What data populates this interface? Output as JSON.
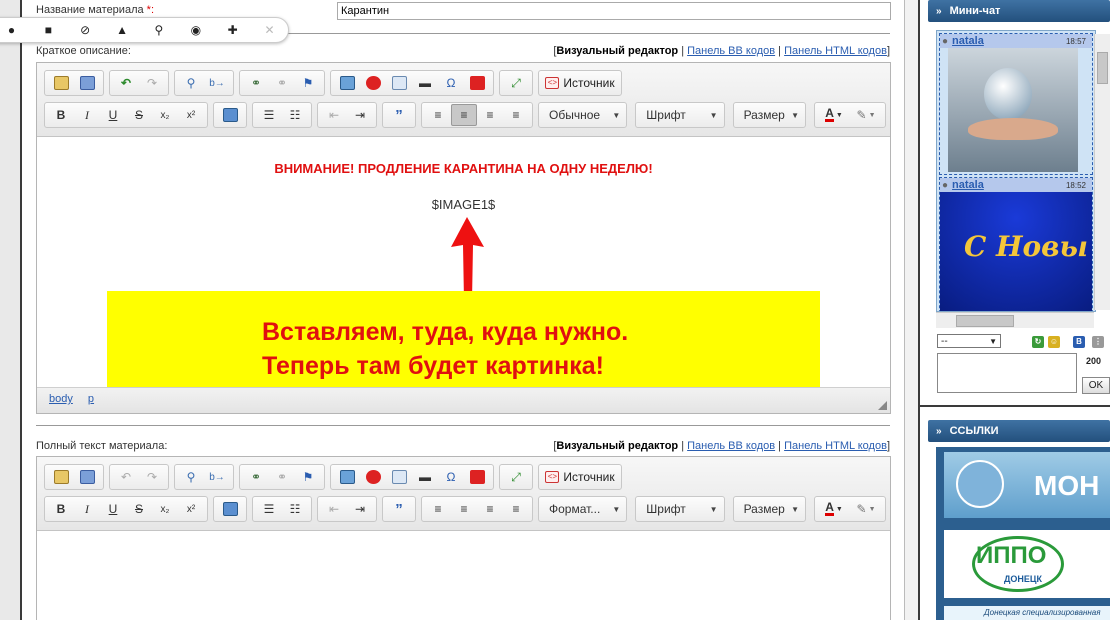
{
  "float_toolbar": {
    "icons": [
      "plus-icon",
      "folder-icon",
      "block-icon",
      "bell-icon",
      "search-icon",
      "eye-icon",
      "puzzle-icon",
      "close-icon"
    ]
  },
  "form": {
    "title_label": "Название материала",
    "required_mark": "*:",
    "title_value": "Карантин",
    "short_label": "Краткое описание:",
    "full_label": "Полный текст материала:"
  },
  "modes": {
    "visual": "Визуальный редактор",
    "bb": "Панель BB кодов",
    "html": "Панель HTML кодов",
    "sep": "|",
    "open": "[",
    "close": "]"
  },
  "editor1": {
    "source_label": "Источник",
    "format_combo": "Обычное",
    "font_combo": "Шрифт",
    "size_combo": "Размер",
    "warning_text": "ВНИМАНИЕ! ПРОДЛЕНИЕ КАРАНТИНА НА ОДНУ НЕДЕЛЮ!",
    "image_placeholder": "$IMAGE1$",
    "callout_line1": "Вставляем, туда, куда нужно.",
    "callout_line2": "Теперь там будет картинка!",
    "path_body": "body",
    "path_p": "p"
  },
  "editor2": {
    "source_label": "Источник",
    "format_combo": "Формат...",
    "font_combo": "Шрифт",
    "size_combo": "Размер"
  },
  "sidebar": {
    "minichat_title": "Мини-чат",
    "links_title": "ССЫЛКИ",
    "messages": [
      {
        "user": "natala",
        "time": "18:57"
      },
      {
        "user": "natala",
        "time": "18:52"
      }
    ],
    "greeting_text": "С Новы",
    "select_value": "--",
    "counter": "200",
    "ok_label": "OK",
    "icon_letter": "B",
    "banner1_text": "МОН",
    "banner2_text": "ИППО",
    "banner2_sub": "ДОНЕЦК",
    "banner3_text": "Донецкая специализированная"
  },
  "colors": {
    "accent_red": "#e01010",
    "highlight_yellow": "#ffff00",
    "panel_blue": "#2a5a8a",
    "link_blue": "#2a5db0"
  }
}
